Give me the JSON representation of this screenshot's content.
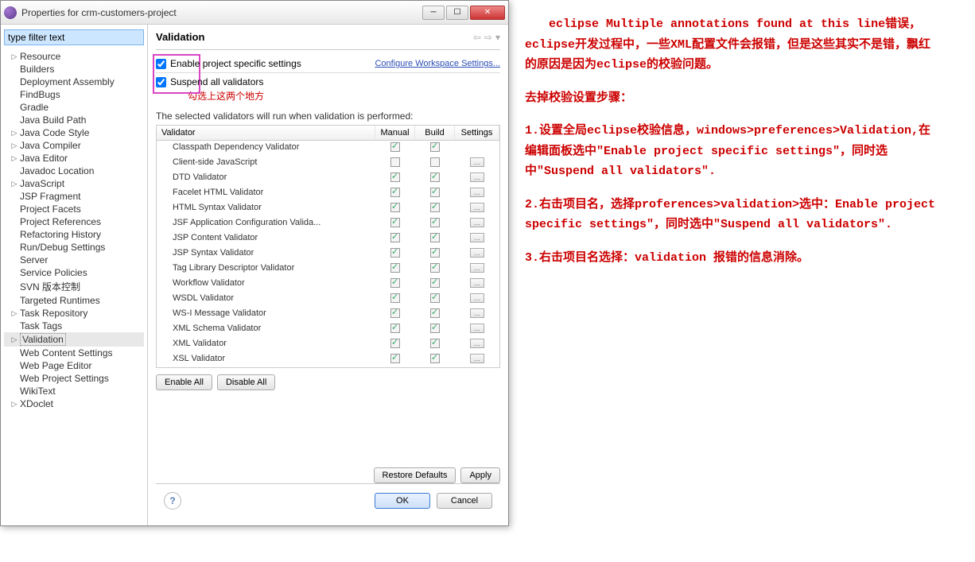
{
  "window": {
    "title": "Properties for crm-customers-project",
    "filter_placeholder": "type filter text"
  },
  "tree": [
    {
      "label": "Resource",
      "expandable": true
    },
    {
      "label": "Builders"
    },
    {
      "label": "Deployment Assembly"
    },
    {
      "label": "FindBugs"
    },
    {
      "label": "Gradle"
    },
    {
      "label": "Java Build Path"
    },
    {
      "label": "Java Code Style",
      "expandable": true
    },
    {
      "label": "Java Compiler",
      "expandable": true
    },
    {
      "label": "Java Editor",
      "expandable": true
    },
    {
      "label": "Javadoc Location"
    },
    {
      "label": "JavaScript",
      "expandable": true
    },
    {
      "label": "JSP Fragment"
    },
    {
      "label": "Project Facets"
    },
    {
      "label": "Project References"
    },
    {
      "label": "Refactoring History"
    },
    {
      "label": "Run/Debug Settings"
    },
    {
      "label": "Server"
    },
    {
      "label": "Service Policies"
    },
    {
      "label": "SVN 版本控制"
    },
    {
      "label": "Targeted Runtimes"
    },
    {
      "label": "Task Repository",
      "expandable": true
    },
    {
      "label": "Task Tags"
    },
    {
      "label": "Validation",
      "expandable": true,
      "selected": true
    },
    {
      "label": "Web Content Settings"
    },
    {
      "label": "Web Page Editor"
    },
    {
      "label": "Web Project Settings"
    },
    {
      "label": "WikiText"
    },
    {
      "label": "XDoclet",
      "expandable": true
    }
  ],
  "main": {
    "heading": "Validation",
    "enable_project": "Enable project specific settings",
    "configure_link": "Configure Workspace Settings...",
    "suspend": "Suspend all validators",
    "annotation": "勾选上这两个地方",
    "desc": "The selected validators will run when validation is performed:",
    "cols": {
      "c0": "Validator",
      "c1": "Manual",
      "c2": "Build",
      "c3": "Settings"
    },
    "rows": [
      {
        "name": "Classpath Dependency Validator",
        "m": true,
        "b": true,
        "s": false
      },
      {
        "name": "Client-side JavaScript",
        "m": false,
        "b": false,
        "s": true
      },
      {
        "name": "DTD Validator",
        "m": true,
        "b": true,
        "s": true
      },
      {
        "name": "Facelet HTML Validator",
        "m": true,
        "b": true,
        "s": true
      },
      {
        "name": "HTML Syntax Validator",
        "m": true,
        "b": true,
        "s": true
      },
      {
        "name": "JSF Application Configuration Valida...",
        "m": true,
        "b": true,
        "s": true
      },
      {
        "name": "JSP Content Validator",
        "m": true,
        "b": true,
        "s": true
      },
      {
        "name": "JSP Syntax Validator",
        "m": true,
        "b": true,
        "s": true
      },
      {
        "name": "Tag Library Descriptor Validator",
        "m": true,
        "b": true,
        "s": true
      },
      {
        "name": "Workflow Validator",
        "m": true,
        "b": true,
        "s": true
      },
      {
        "name": "WSDL Validator",
        "m": true,
        "b": true,
        "s": true
      },
      {
        "name": "WS-I Message Validator",
        "m": true,
        "b": true,
        "s": true
      },
      {
        "name": "XML Schema Validator",
        "m": true,
        "b": true,
        "s": true
      },
      {
        "name": "XML Validator",
        "m": true,
        "b": true,
        "s": true
      },
      {
        "name": "XSL Validator",
        "m": true,
        "b": true,
        "s": true
      }
    ],
    "enable_all": "Enable All",
    "disable_all": "Disable All",
    "restore": "Restore Defaults",
    "apply": "Apply",
    "ok": "OK",
    "cancel": "Cancel"
  },
  "notes": {
    "p1": "　　eclipse Multiple annotations found at this line错误，eclipse开发过程中，一些XML配置文件会报错，但是这些其实不是错，飘红的原因是因为eclipse的校验问题。",
    "p2": "去掉校验设置步骤：",
    "p3": "1.设置全局eclipse校验信息，windows>preferences>Validation,在编辑面板选中\"Enable project specific settings\"，同时选中\"Suspend all validators\".",
    "p4": "2.右击项目名，选择proferences>validation>选中：Enable project specific settings\"，同时选中\"Suspend all validators\".",
    "p5": "3.右击项目名选择：validation 报错的信息消除。"
  }
}
